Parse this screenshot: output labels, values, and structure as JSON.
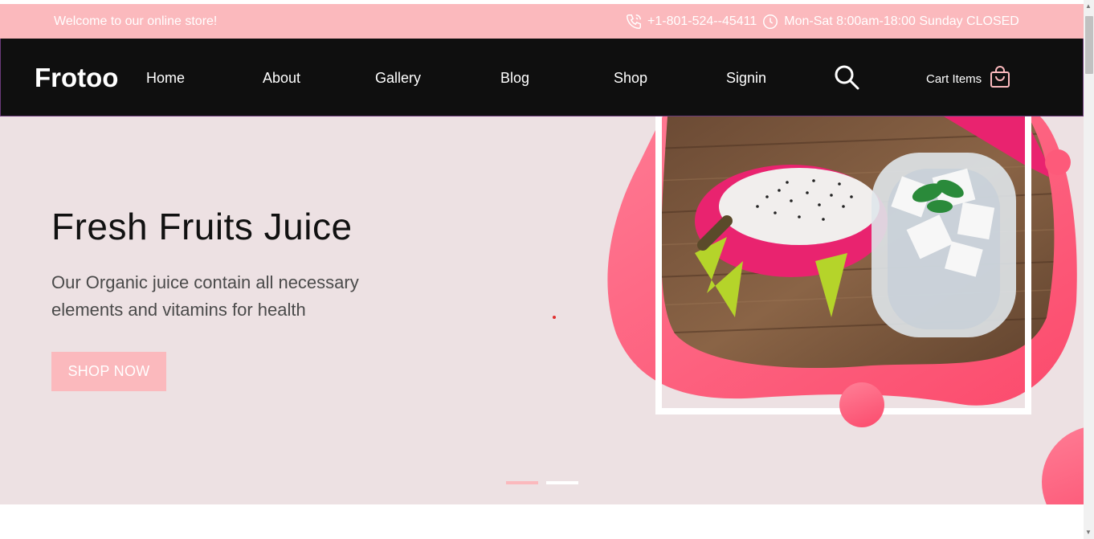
{
  "topbar": {
    "welcome": "Welcome to our online store!",
    "phone": "+1-801-524--45411",
    "hours": "Mon-Sat 8:00am-18:00 Sunday CLOSED"
  },
  "navbar": {
    "logo": "Frotoo",
    "items": [
      "Home",
      "About",
      "Gallery",
      "Blog",
      "Shop",
      "Signin"
    ],
    "cart_label": "Cart Items"
  },
  "hero": {
    "title": "Fresh Fruits Juice",
    "text": "Our Organic juice contain all necessary elements and vitamins for health",
    "button": "SHOP NOW"
  },
  "colors": {
    "topbar_bg": "#fbb9bd",
    "navbar_bg": "#0f0f0f",
    "hero_bg": "#ede1e3",
    "accent": "#fb4a6c"
  },
  "icons": [
    "phone-icon",
    "clock-icon",
    "search-icon",
    "shopping-bag-icon",
    "dragon-fruit-juice-image"
  ]
}
